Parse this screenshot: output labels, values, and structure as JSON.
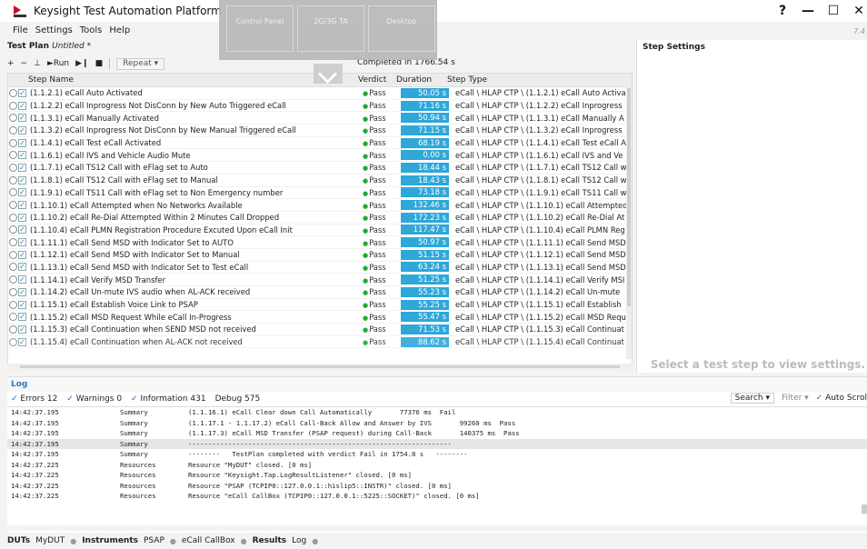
{
  "window": {
    "title": "Keysight Test Automation Platform",
    "controls": [
      "?",
      "—",
      "☐",
      "✕"
    ],
    "version_text": "7.4"
  },
  "overlay": {
    "tabs": [
      "Control Panel",
      "2G/3G TA",
      "Desktop"
    ]
  },
  "menu": [
    "File",
    "Settings",
    "Tools",
    "Help"
  ],
  "plan": {
    "label": "Test Plan",
    "name": "Untitled *"
  },
  "toolbar": {
    "add": "+",
    "remove": "−",
    "insert": "⊥",
    "run": "►Run",
    "step": "▶❙",
    "stop": "■",
    "repeat": "Repeat ▾"
  },
  "status": {
    "completed": "Completed in 1766.54 s"
  },
  "columns": {
    "name": "Step Name",
    "verdict": "Verdict",
    "duration": "Duration",
    "type": "Step Type"
  },
  "steps": [
    {
      "name": "(1.1.2.1) eCall Auto Activated",
      "verdict": "Pass",
      "duration": "50.05 s",
      "type": "eCall \\ HLAP CTP \\ (1.1.2.1) eCall Auto Activa"
    },
    {
      "name": "(1.1.2.2) eCall Inprogress Not DisConn by New Auto Triggered eCall",
      "verdict": "Pass",
      "duration": "71.16 s",
      "type": "eCall \\ HLAP CTP \\ (1.1.2.2) eCall Inprogress"
    },
    {
      "name": "(1.1.3.1) eCall Manually Activated",
      "verdict": "Pass",
      "duration": "50.94 s",
      "type": "eCall \\ HLAP CTP \\ (1.1.3.1) eCall Manually A"
    },
    {
      "name": "(1.1.3.2) eCall Inprogress Not DisConn by New Manual Triggered eCall",
      "verdict": "Pass",
      "duration": "71.15 s",
      "type": "eCall \\ HLAP CTP \\ (1.1.3.2) eCall Inprogress"
    },
    {
      "name": "(1.1.4.1) eCall Test eCall Activated",
      "verdict": "Pass",
      "duration": "68.19 s",
      "type": "eCall \\ HLAP CTP \\ (1.1.4.1) eCall Test eCall A"
    },
    {
      "name": "(1.1.6.1) eCall IVS and Vehicle Audio Mute",
      "verdict": "Pass",
      "duration": "0.00 s",
      "type": "eCall \\ HLAP CTP \\ (1.1.6.1) eCall IVS and Ve"
    },
    {
      "name": "(1.1.7.1) eCall TS12 Call with eFlag set to Auto",
      "verdict": "Pass",
      "duration": "18.44 s",
      "type": "eCall \\ HLAP CTP \\ (1.1.7.1) eCall TS12 Call w"
    },
    {
      "name": "(1.1.8.1) eCall TS12 Call with eFlag set to Manual",
      "verdict": "Pass",
      "duration": "18.43 s",
      "type": "eCall \\ HLAP CTP \\ (1.1.8.1) eCall TS12 Call w"
    },
    {
      "name": "(1.1.9.1) eCall TS11 Call with eFlag set to Non Emergency number",
      "verdict": "Pass",
      "duration": "73.18 s",
      "type": "eCall \\ HLAP CTP \\ (1.1.9.1) eCall TS11 Call w"
    },
    {
      "name": "(1.1.10.1) eCall Attempted when No Networks Available",
      "verdict": "Pass",
      "duration": "132.46 s",
      "type": "eCall \\ HLAP CTP \\ (1.1.10.1) eCall Attempted"
    },
    {
      "name": "(1.1.10.2) eCall Re-Dial Attempted Within 2 Minutes Call Dropped",
      "verdict": "Pass",
      "duration": "172.23 s",
      "type": "eCall \\ HLAP CTP \\ (1.1.10.2) eCall Re-Dial At"
    },
    {
      "name": "(1.1.10.4) eCall PLMN Registration Procedure Excuted Upon eCall Init",
      "verdict": "Pass",
      "duration": "117.47 s",
      "type": "eCall \\ HLAP CTP \\ (1.1.10.4) eCall PLMN Reg"
    },
    {
      "name": "(1.1.11.1) eCall Send MSD with Indicator Set to AUTO",
      "verdict": "Pass",
      "duration": "50.97 s",
      "type": "eCall \\ HLAP CTP \\ (1.1.11.1) eCall Send MSD"
    },
    {
      "name": "(1.1.12.1) eCall Send MSD with Indicator Set to Manual",
      "verdict": "Pass",
      "duration": "51.15 s",
      "type": "eCall \\ HLAP CTP \\ (1.1.12.1) eCall Send MSD"
    },
    {
      "name": "(1.1.13.1) eCall Send MSD with Indicator Set to Test eCall",
      "verdict": "Pass",
      "duration": "63.24 s",
      "type": "eCall \\ HLAP CTP \\ (1.1.13.1) eCall Send MSD"
    },
    {
      "name": "(1.1.14.1) eCall Verify MSD Transfer",
      "verdict": "Pass",
      "duration": "51.25 s",
      "type": "eCall \\ HLAP CTP \\ (1.1.14.1) eCall Verify MSI"
    },
    {
      "name": "(1.1.14.2) eCall Un-mute IVS audio when AL-ACK received",
      "verdict": "Pass",
      "duration": "55.23 s",
      "type": "eCall \\ HLAP CTP \\ (1.1.14.2) eCall Un-mute"
    },
    {
      "name": "(1.1.15.1) eCall Establish Voice Link to PSAP",
      "verdict": "Pass",
      "duration": "55.25 s",
      "type": "eCall \\ HLAP CTP \\ (1.1.15.1) eCall Establish"
    },
    {
      "name": "(1.1.15.2) eCall MSD Request While eCall In-Progress",
      "verdict": "Pass",
      "duration": "55.47 s",
      "type": "eCall \\ HLAP CTP \\ (1.1.15.2) eCall MSD Requ"
    },
    {
      "name": "(1.1.15.3) eCall Continuation when SEND MSD not received",
      "verdict": "Pass",
      "duration": "71.53 s",
      "type": "eCall \\ HLAP CTP \\ (1.1.15.3) eCall Continuat"
    },
    {
      "name": "(1.1.15.4) eCall Continuation when AL-ACK not received",
      "verdict": "Pass",
      "duration": "88.62 s",
      "type": "eCall \\ HLAP CTP \\ (1.1.15.4) eCall Continuat"
    }
  ],
  "step_settings": {
    "title": "Step Settings",
    "empty": "Select a test step to view settings."
  },
  "log": {
    "title": "Log",
    "filters": {
      "errors": "Errors 12",
      "warnings": "Warnings 0",
      "information": "Information 431",
      "debug": "Debug 575"
    },
    "search": "Search ▾",
    "filter": "Filter ▾",
    "autoscroll": "Auto Scrol",
    "lines": [
      {
        "time": "14:42:37.195",
        "src": "Summary",
        "msg": "(1.1.16.1) eCall Clear down Call Automatically       77376 ms  Fail"
      },
      {
        "time": "14:42:37.195",
        "src": "Summary",
        "msg": "(1.1.17.1 - 1.1.17.2) eCall Call-Back Allow and Answer by IVS       99260 ms  Pass"
      },
      {
        "time": "14:42:37.195",
        "src": "Summary",
        "msg": "(1.1.17.3) eCall MSD Transfer (PSAP request) during Call-Back       140375 ms  Pass"
      },
      {
        "time": "14:42:37.195",
        "src": "Summary",
        "msg": "------------------------------------------------------------------"
      },
      {
        "time": "14:42:37.195",
        "src": "Summary",
        "msg": "--------   TestPlan completed with verdict Fail in 1754.8 s   --------"
      },
      {
        "time": "14:42:37.225",
        "src": "Resources",
        "msg": "Resource \"MyDUT\" closed. [0 ms]"
      },
      {
        "time": "14:42:37.225",
        "src": "Resources",
        "msg": "Resource \"Keysight.Tap.LogResultListener\" closed. [0 ms]"
      },
      {
        "time": "14:42:37.225",
        "src": "Resources",
        "msg": "Resource \"PSAP (TCPIP0::127.0.0.1::hislip5::INSTR)\" closed. [0 ms]"
      },
      {
        "time": "14:42:37.225",
        "src": "Resources",
        "msg": "Resource \"eCall CallBox (TCPIP0::127.0.0.1::5225::SOCKET)\" closed. [0 ms]"
      }
    ]
  },
  "statusbar": {
    "duts_label": "DUTs",
    "duts": "MyDUT",
    "instruments_label": "Instruments",
    "instr1": "PSAP",
    "instr2": "eCall CallBox",
    "results_label": "Results",
    "results": "Log"
  }
}
